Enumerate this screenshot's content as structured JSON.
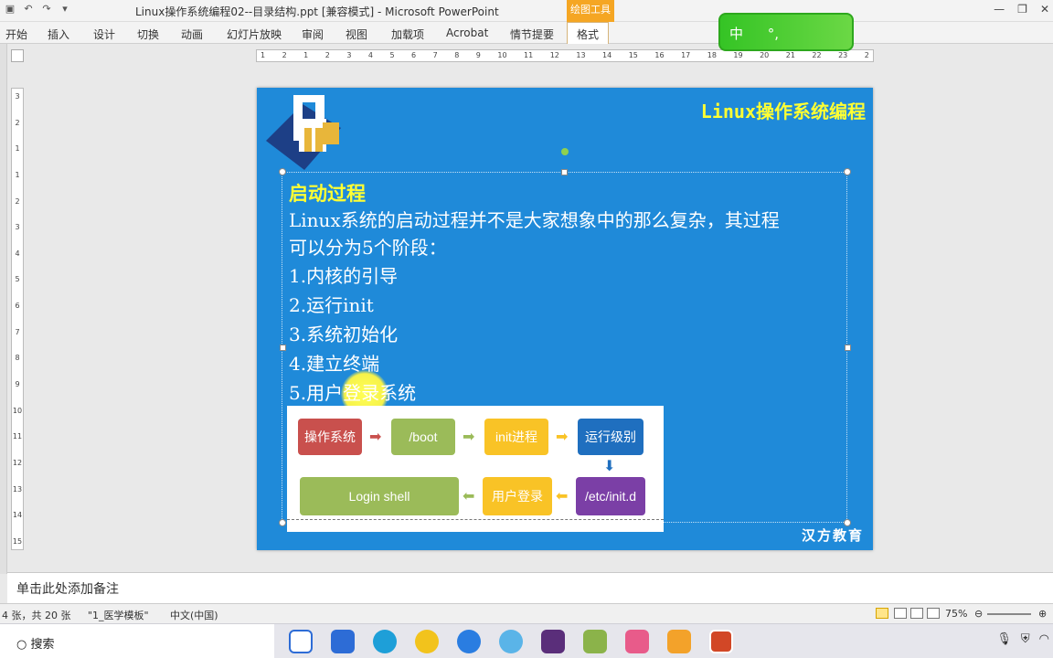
{
  "window": {
    "title": "Linux操作系统编程02--目录结构.ppt [兼容模式] - Microsoft PowerPoint",
    "contextual_tab_group": "绘图工具",
    "qat_icons": [
      "save-icon",
      "undo-icon",
      "redo-icon",
      "dropdown-icon"
    ],
    "controls": [
      "—",
      "❐",
      "✕"
    ]
  },
  "ribbon": {
    "tabs": [
      "开始",
      "插入",
      "设计",
      "切换",
      "动画",
      "幻灯片放映",
      "审阅",
      "视图",
      "加载项",
      "Acrobat",
      "情节提要",
      "格式"
    ],
    "active_tab": "格式"
  },
  "ime": {
    "lang": "中",
    "punct": "°,"
  },
  "ruler": {
    "horizontal": [
      "1",
      "2",
      "1",
      "2",
      "3",
      "4",
      "5",
      "6",
      "7",
      "8",
      "9",
      "10",
      "11",
      "12",
      "13",
      "14",
      "15",
      "16",
      "17",
      "18",
      "19",
      "20",
      "21",
      "22",
      "23",
      "2"
    ],
    "vertical": [
      "3",
      "2",
      "1",
      "1",
      "2",
      "3",
      "4",
      "5",
      "6",
      "7",
      "8",
      "9",
      "10",
      "11",
      "12",
      "13",
      "14",
      "15"
    ]
  },
  "slide": {
    "brand": "Linux操作系统编程",
    "heading": "启动过程",
    "paragraph": [
      "Linux系统的启动过程并不是大家想象中的那么复杂，其过程",
      "可以分为5个阶段："
    ],
    "items": [
      "1.内核的引导",
      "2.运行init",
      "3.系统初始化",
      "4.建立终端",
      "5.用户登录系统"
    ],
    "flow": {
      "os": "操作系统",
      "boot": "/boot",
      "init": "init进程",
      "runlevel": "运行级别",
      "etc": "/etc/init.d",
      "userlogin": "用户登录",
      "shell": "Login shell",
      "colors": {
        "red": "#c9504d",
        "green": "#9bbb59",
        "yellow": "#f9c326",
        "blue": "#1f6fbf",
        "purple": "#7b3fa6"
      }
    },
    "footer": "汉方教育",
    "background": "#1f8ad9"
  },
  "notes": {
    "placeholder": "单击此处添加备注"
  },
  "status": {
    "slide": "4 张，共 20 张",
    "theme": "\"1_医学模板\"",
    "lang": "中文(中国)",
    "zoom": "75%",
    "minus": "⊖",
    "plus": "⊕"
  },
  "taskbar": {
    "search": "搜索",
    "search_icon": "search-icon"
  }
}
